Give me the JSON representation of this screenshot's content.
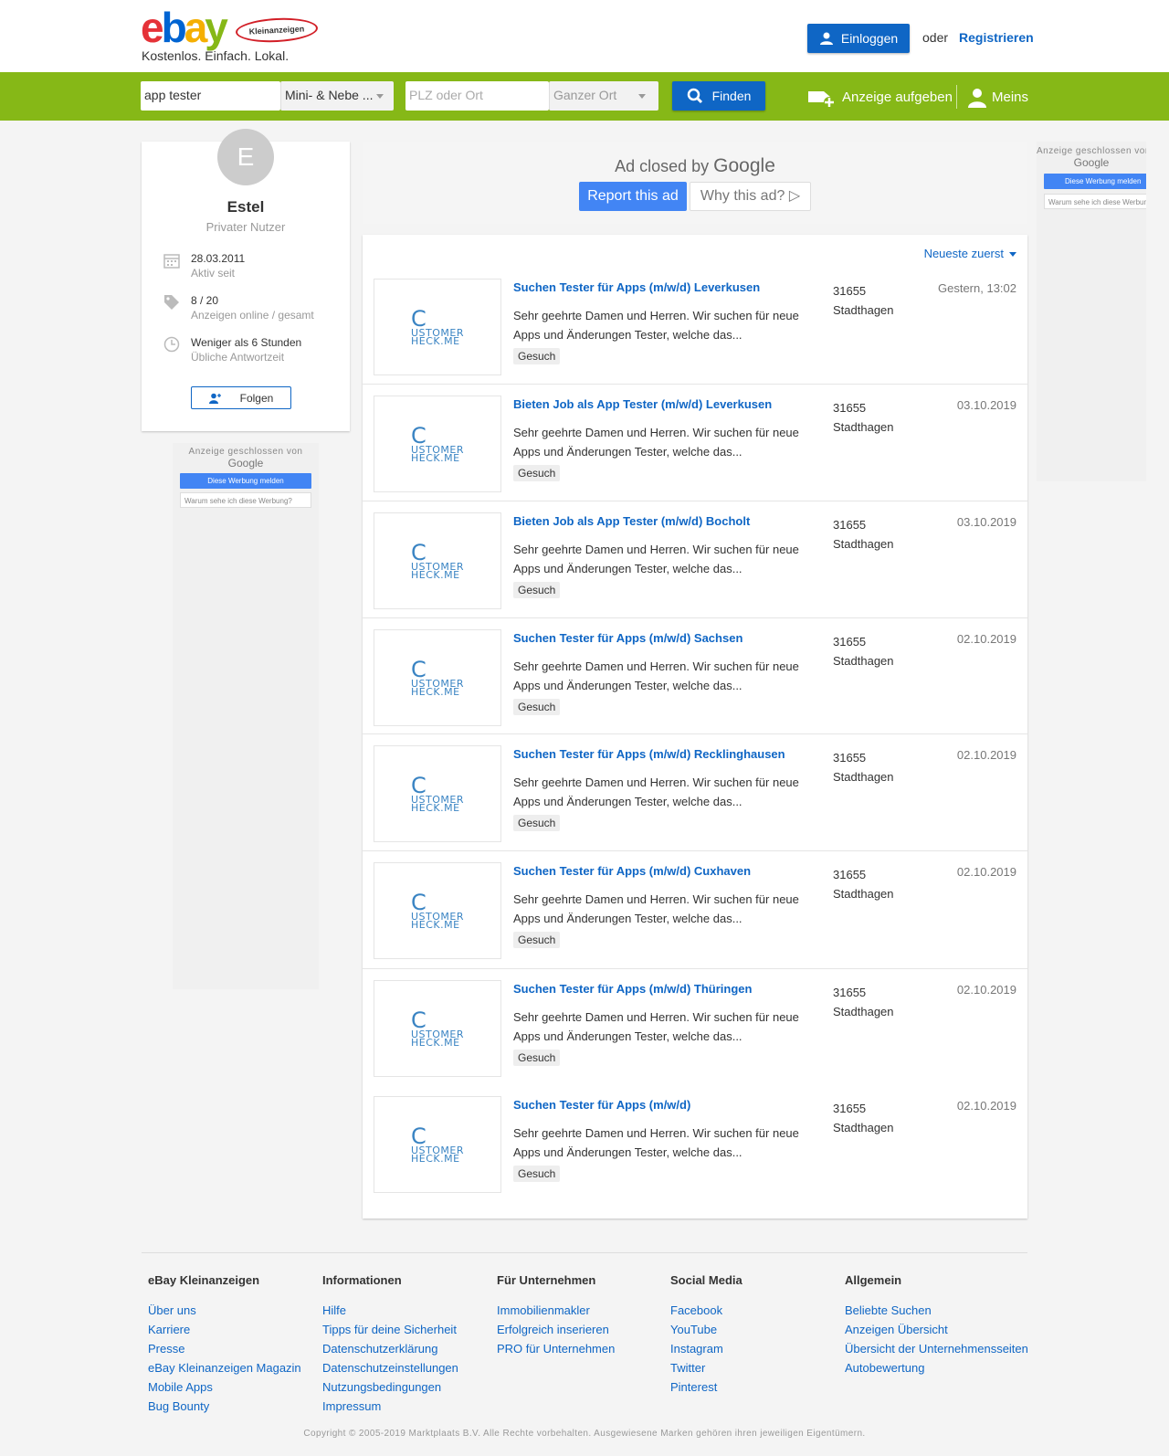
{
  "header": {
    "logo_text": "ebay",
    "logo_badge": "Kleinanzeigen",
    "tagline": "Kostenlos. Einfach. Lokal.",
    "login_label": "Einloggen",
    "or_label": "oder",
    "register_label": "Registrieren"
  },
  "search": {
    "query_value": "app tester",
    "category_value": "Mini- & Nebe ...",
    "plz_placeholder": "PLZ oder Ort",
    "radius_value": "Ganzer Ort",
    "find_label": "Finden",
    "post_ad_label": "Anzeige aufgeben",
    "meins_label": "Meins"
  },
  "profile": {
    "avatar_letter": "E",
    "name": "Estel",
    "type": "Privater Nutzer",
    "active_date": "28.03.2011",
    "active_label": "Aktiv seit",
    "ads_count": "8 / 20",
    "ads_label": "Anzeigen online / gesamt",
    "response_time": "Weniger als 6 Stunden",
    "response_label": "Übliche Antwortzeit",
    "follow_label": "Folgen"
  },
  "ads": {
    "top_title": "Ad closed by",
    "top_google": "Google",
    "report_label": "Report this ad",
    "why_label": "Why this ad?",
    "small_title": "Anzeige geschlossen von",
    "small_google": "Google",
    "small_report": "Diese Werbung melden",
    "small_why": "Warum sehe ich diese Werbung?"
  },
  "listings": {
    "sort_label": "Neueste zuerst",
    "logo_big": "C",
    "logo_line1": "USTOMER",
    "logo_line2": "HECK.ME",
    "items": [
      {
        "title": "Suchen Tester für Apps (m/w/d) Leverkusen",
        "desc": "Sehr geehrte Damen und Herren. Wir suchen für neue Apps und Änderungen Tester, welche das...",
        "tag": "Gesuch",
        "zip": "31655",
        "city": "Stadthagen",
        "date": "Gestern, 13:02"
      },
      {
        "title": "Bieten Job als App Tester (m/w/d) Leverkusen",
        "desc": "Sehr geehrte Damen und Herren. Wir suchen für neue Apps und Änderungen Tester, welche das...",
        "tag": "Gesuch",
        "zip": "31655",
        "city": "Stadthagen",
        "date": "03.10.2019"
      },
      {
        "title": "Bieten Job als App Tester (m/w/d) Bocholt",
        "desc": "Sehr geehrte Damen und Herren. Wir suchen für neue Apps und Änderungen Tester, welche das...",
        "tag": "Gesuch",
        "zip": "31655",
        "city": "Stadthagen",
        "date": "03.10.2019"
      },
      {
        "title": "Suchen Tester für Apps (m/w/d) Sachsen",
        "desc": "Sehr geehrte Damen und Herren. Wir suchen für neue Apps und Änderungen Tester, welche das...",
        "tag": "Gesuch",
        "zip": "31655",
        "city": "Stadthagen",
        "date": "02.10.2019"
      },
      {
        "title": "Suchen Tester für Apps (m/w/d) Recklinghausen",
        "desc": "Sehr geehrte Damen und Herren. Wir suchen für neue Apps und Änderungen Tester, welche das...",
        "tag": "Gesuch",
        "zip": "31655",
        "city": "Stadthagen",
        "date": "02.10.2019"
      },
      {
        "title": "Suchen Tester für Apps (m/w/d) Cuxhaven",
        "desc": "Sehr geehrte Damen und Herren. Wir suchen für neue Apps und Änderungen Tester, welche das...",
        "tag": "Gesuch",
        "zip": "31655",
        "city": "Stadthagen",
        "date": "02.10.2019"
      },
      {
        "title": "Suchen Tester für Apps (m/w/d) Thüringen",
        "desc": "Sehr geehrte Damen und Herren. Wir suchen für neue Apps und Änderungen Tester, welche das...",
        "tag": "Gesuch",
        "zip": "31655",
        "city": "Stadthagen",
        "date": "02.10.2019"
      },
      {
        "title": "Suchen Tester für Apps (m/w/d)",
        "desc": "Sehr geehrte Damen und Herren. Wir suchen für neue Apps und Änderungen Tester, welche das...",
        "tag": "Gesuch",
        "zip": "31655",
        "city": "Stadthagen",
        "date": "02.10.2019"
      }
    ]
  },
  "footer": {
    "columns": [
      {
        "title": "eBay Kleinanzeigen",
        "links": [
          "Über uns",
          "Karriere",
          "Presse",
          "eBay Kleinanzeigen Magazin",
          "Mobile Apps",
          "Bug Bounty"
        ]
      },
      {
        "title": "Informationen",
        "links": [
          "Hilfe",
          "Tipps für deine Sicherheit",
          "Datenschutzerklärung",
          "Datenschutzeinstellungen",
          "Nutzungsbedingungen",
          "Impressum"
        ]
      },
      {
        "title": "Für Unternehmen",
        "links": [
          "Immobilienmakler",
          "Erfolgreich inserieren",
          "PRO für Unternehmen"
        ]
      },
      {
        "title": "Social Media",
        "links": [
          "Facebook",
          "YouTube",
          "Instagram",
          "Twitter",
          "Pinterest"
        ]
      },
      {
        "title": "Allgemein",
        "links": [
          "Beliebte Suchen",
          "Anzeigen Übersicht",
          "Übersicht der Unternehmensseiten",
          "Autobewertung"
        ]
      }
    ],
    "copyright": "Copyright © 2005-2019 Marktplaats B.V. Alle Rechte vorbehalten. Ausgewiesene Marken gehören ihren jeweiligen Eigentümern."
  },
  "colors": {
    "brand_green": "#86b817",
    "link_blue": "#0f66c5",
    "google_blue": "#4285f4"
  }
}
